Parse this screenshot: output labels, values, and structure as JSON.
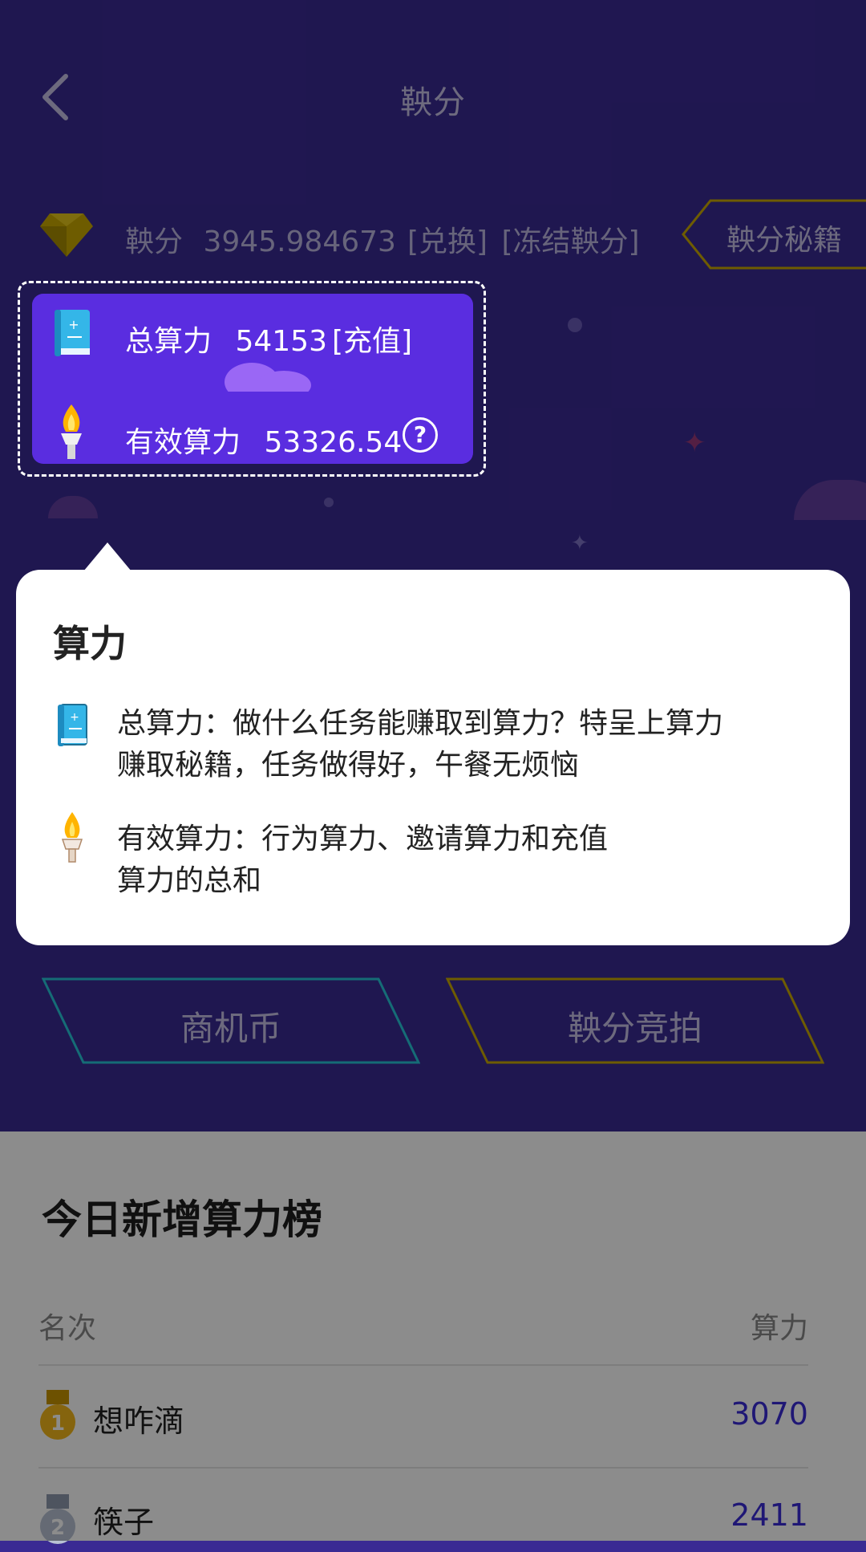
{
  "header": {
    "title": "鞅分"
  },
  "score": {
    "label": "鞅分",
    "value": "3945.984673",
    "exchange": "[兑换]",
    "frozen": "[冻结鞅分]"
  },
  "secret_button": "鞅分秘籍",
  "power_card": {
    "total_label": "总算力",
    "total_value": "54153",
    "recharge": "[充值]",
    "effective_label": "有效算力",
    "effective_value": "53326.54",
    "help": "?"
  },
  "buttons": {
    "coin": "商机币",
    "auction": "鞅分竞拍"
  },
  "popup": {
    "title": "算力",
    "total_line1": "总算力：做什么任务能赚取到算力？特呈上算力",
    "total_line2": "赚取秘籍，任务做得好，午餐无烦恼",
    "effective_line1": "有效算力：行为算力、邀请算力和充值",
    "effective_line2": "算力的总和"
  },
  "ranking": {
    "title": "今日新增算力榜",
    "col_rank": "名次",
    "col_power": "算力",
    "rows": [
      {
        "name": "想咋滴",
        "value": "3070"
      },
      {
        "name": "筷子",
        "value": "2411"
      }
    ]
  },
  "colors": {
    "scene": "#3a2a93",
    "card": "#5a2de0",
    "accent": "#3a2bd6",
    "gold": "#c9a800",
    "cyan": "#27c5d8"
  },
  "icons": [
    "back-chevron-icon",
    "gem-icon",
    "book-icon",
    "torch-icon",
    "help-icon",
    "gold-medal-icon",
    "silver-medal-icon"
  ]
}
